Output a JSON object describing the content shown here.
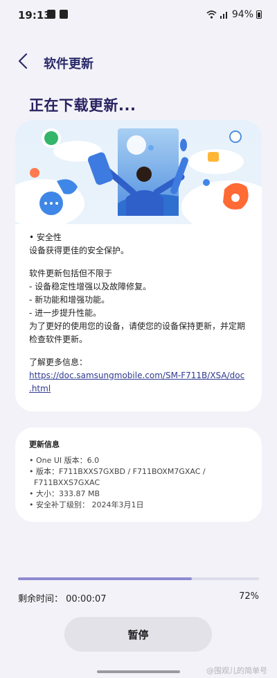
{
  "status_bar": {
    "time": "19:13",
    "battery_text": "94%",
    "icons": [
      "chat-bubble-icon",
      "shopping-bag-icon",
      "wifi-icon",
      "signal-icon",
      "battery-icon"
    ]
  },
  "header": {
    "back_icon": "chevron-left-icon",
    "title": "软件更新"
  },
  "page_title": "正在下载更新...",
  "release_notes": {
    "lines_a": [
      "• 安全性",
      "设备获得更佳的安全保护。"
    ],
    "lines_b": [
      "软件更新包括但不限于",
      "- 设备稳定性增强以及故障修复。",
      "- 新功能和增强功能。",
      "- 进一步提升性能。",
      "为了更好的使用您的设备，请使您的设备保持更新，并定期",
      "检查软件更新。"
    ],
    "more_info_label": "了解更多信息：",
    "link_line1": "https://doc.samsungmobile.com/SM-F711B/XSA/doc",
    "link_line2": ".html"
  },
  "update_info": {
    "title": "更新信息",
    "items": [
      "• One UI 版本：6.0",
      "• 版本：F711BXXS7GXBD / F711BOXM7GXAC /",
      "  F711BXXS7GXAC",
      "• 大小：333.87 MB",
      "• 安全补丁级别： 2024年3月1日"
    ]
  },
  "download": {
    "progress_fraction": 0.72,
    "remaining_label": "剩余时间： 00:00:07",
    "percent_label": "72%"
  },
  "pause_label": "暂停",
  "watermark": "@围观儿的简单号",
  "colors": {
    "accent": "#2a2a6a",
    "progress": "#8f8ad3",
    "link": "#2f3a8f",
    "background": "#f3f2f8"
  }
}
